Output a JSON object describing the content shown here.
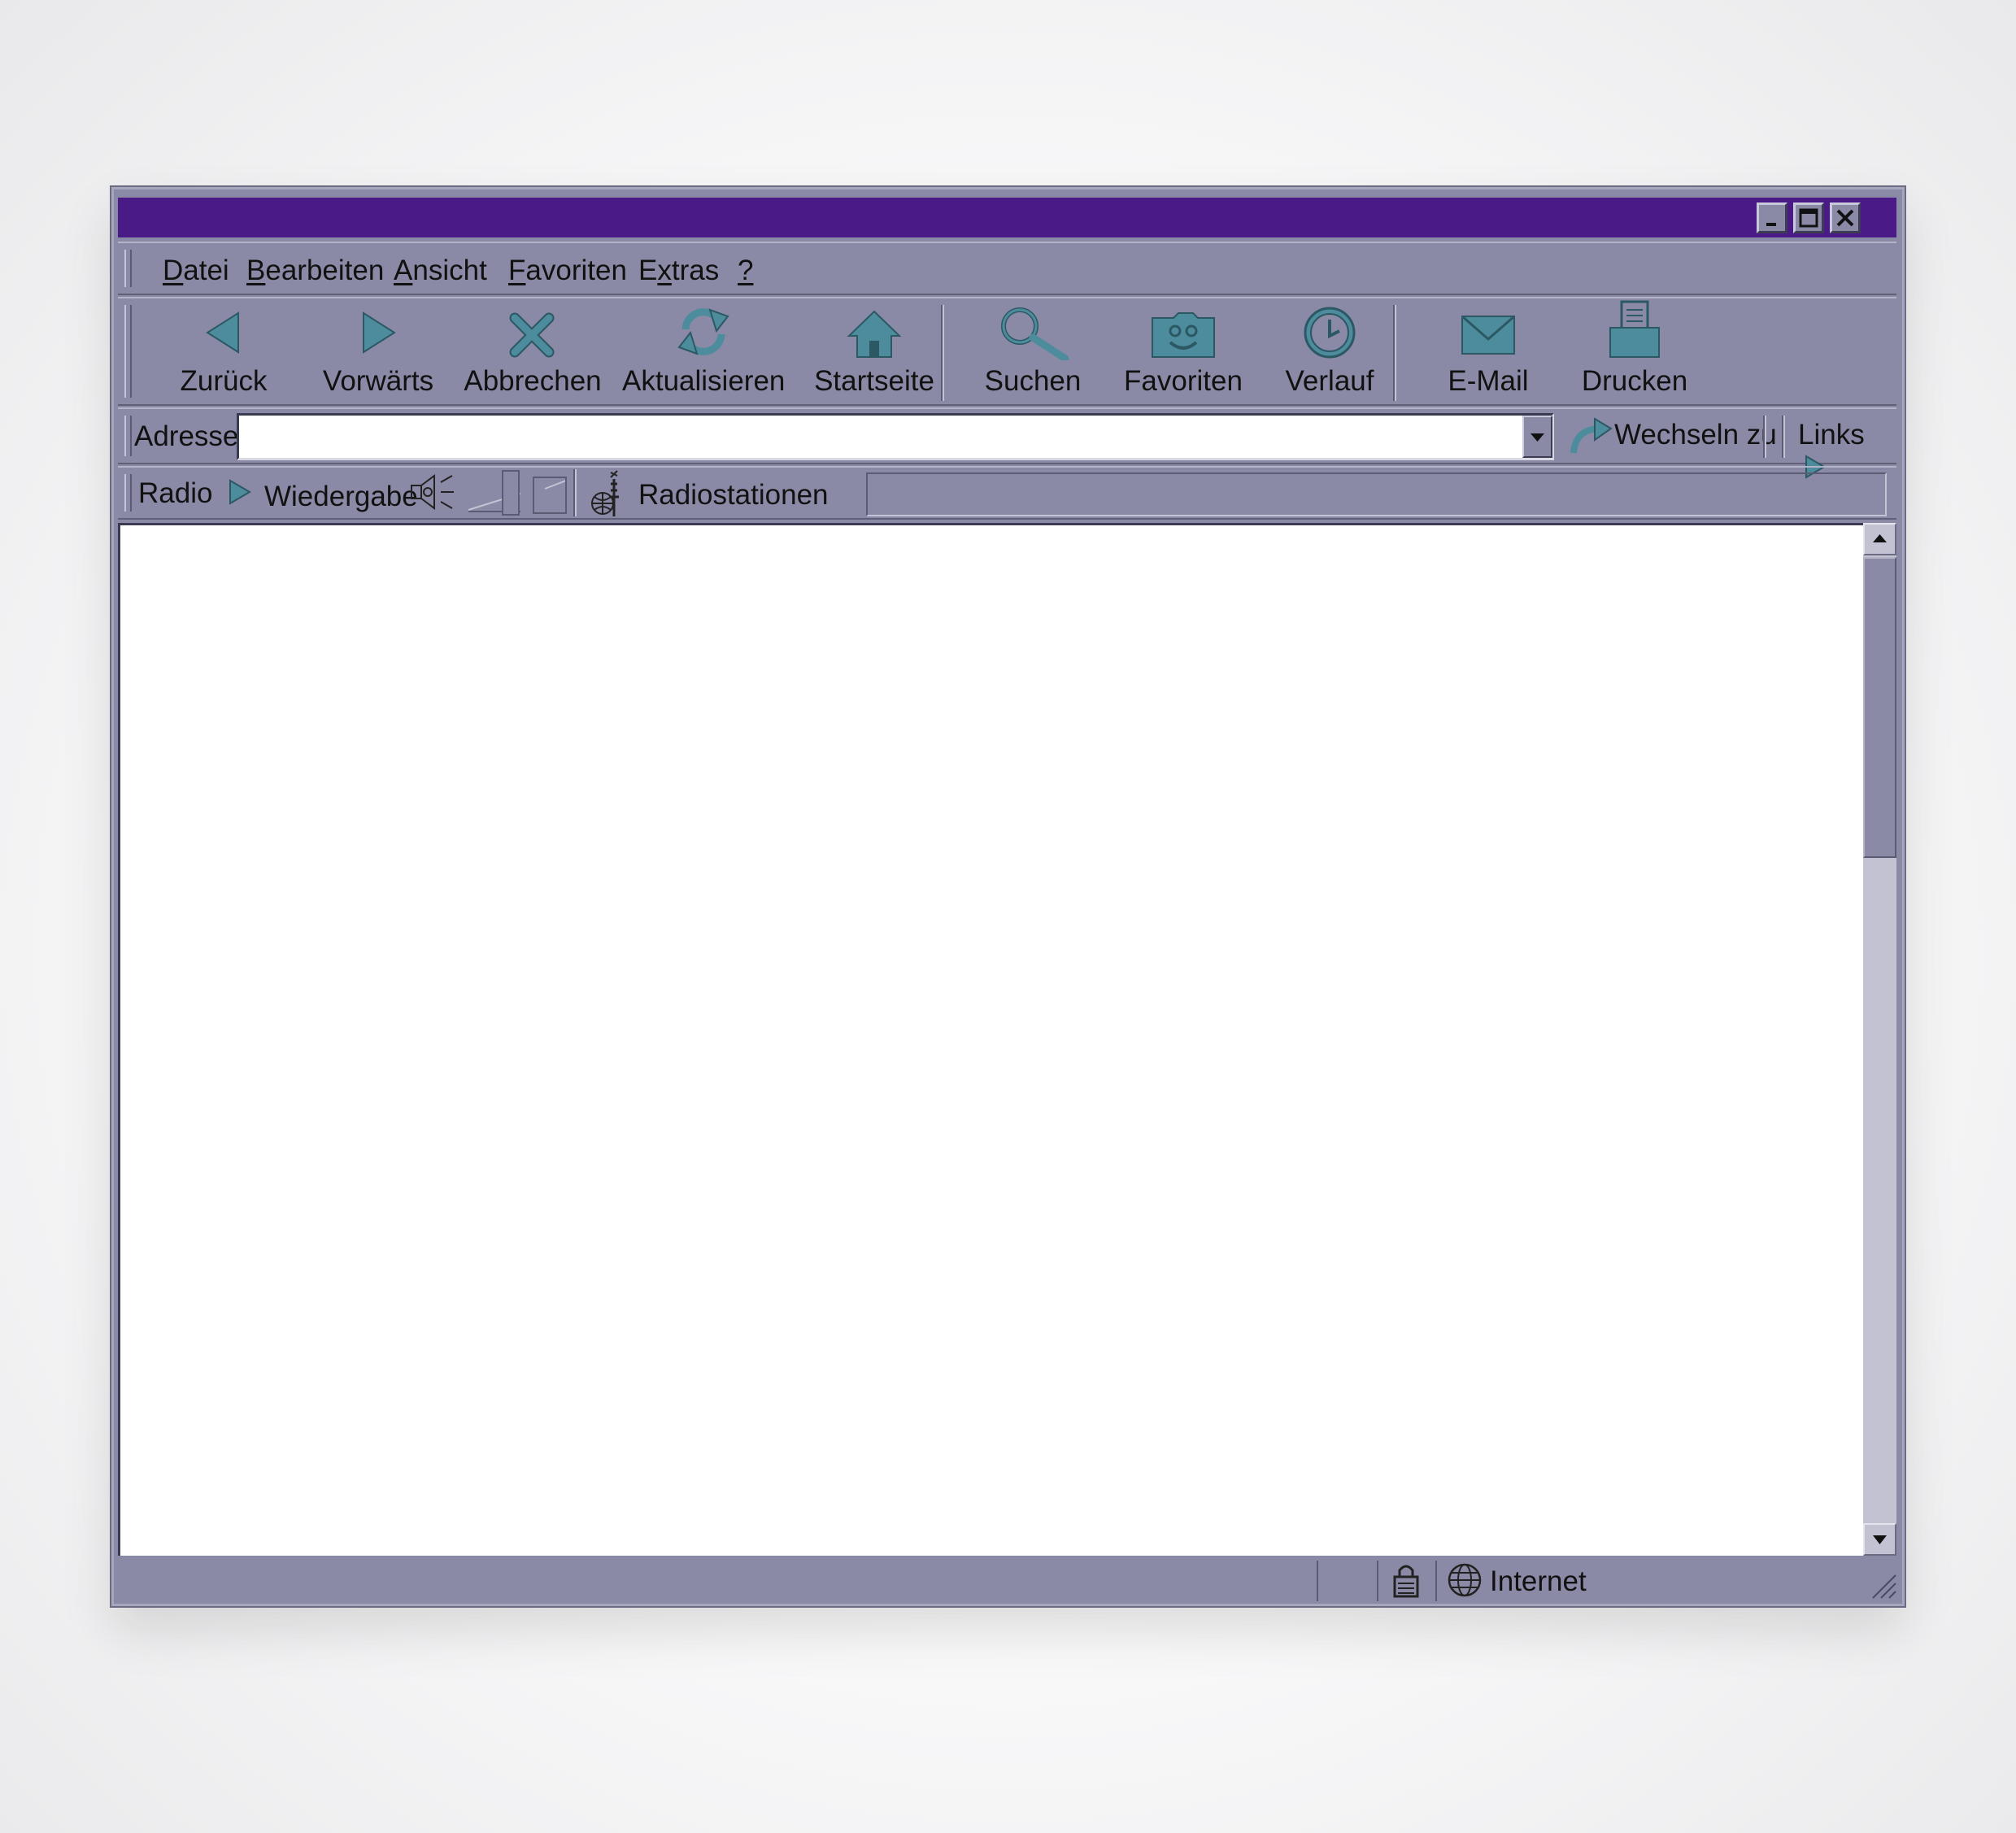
{
  "window": {
    "controls": {
      "minimize_icon": "minimize-icon",
      "maximize_icon": "maximize-icon",
      "close_icon": "close-icon"
    },
    "colors": {
      "titlebar": "#4a1a86",
      "chrome": "#8a8aa6",
      "icon": "#4d8c9c",
      "content": "#ffffff"
    }
  },
  "menu": {
    "items": [
      {
        "accel": "D",
        "rest": "atei"
      },
      {
        "accel": "B",
        "rest": "earbeiten"
      },
      {
        "accel": "A",
        "rest": "nsicht"
      },
      {
        "accel": "F",
        "rest": "avoriten"
      },
      {
        "pre": "E",
        "accel": "x",
        "rest": "tras"
      },
      {
        "accel": "?",
        "rest": ""
      }
    ]
  },
  "toolbar": {
    "back": "Zurück",
    "forward": "Vorwärts",
    "stop": "Abbrechen",
    "refresh": "Aktualisieren",
    "home": "Startseite",
    "search": "Suchen",
    "favorites": "Favoriten",
    "history": "Verlauf",
    "mail": "E-Mail",
    "print": "Drucken"
  },
  "address": {
    "label": "Adresse",
    "value": "",
    "go": "Wechseln zu",
    "links": "Links"
  },
  "radio": {
    "label": "Radio",
    "play": "Wiedergabe",
    "stations": "Radiostationen"
  },
  "status": {
    "zone": "Internet"
  }
}
